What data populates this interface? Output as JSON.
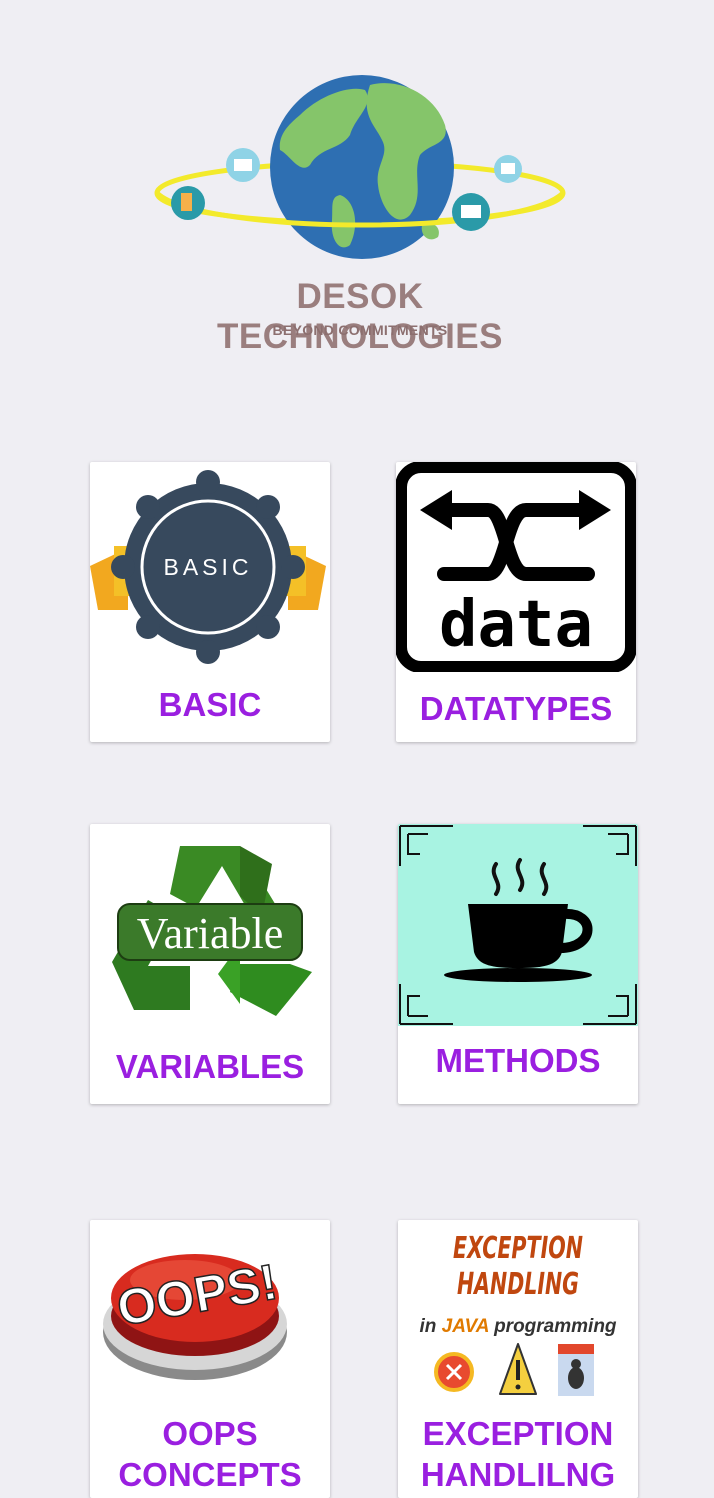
{
  "brand": {
    "name": "DESOK TECHNOLOGIES",
    "tagline": "BEYOND COMMITMENTS",
    "logo_icon": "globe-orbit-logo"
  },
  "cards": [
    {
      "label": "BASIC",
      "icon": "basic-badge-icon",
      "image_text": "BASIC"
    },
    {
      "label": "DATATYPES",
      "icon": "shuffle-data-icon",
      "image_text": "data"
    },
    {
      "label": "VARIABLES",
      "icon": "recycle-variable-icon",
      "image_text": "Variable"
    },
    {
      "label": "METHODS",
      "icon": "coffee-cup-icon"
    },
    {
      "label": "OOPS",
      "label2": "CONCEPTS",
      "icon": "oops-button-icon",
      "image_text": "OOPS!"
    },
    {
      "label": "EXCEPTION",
      "label2": "HANDLILNG",
      "icon": "exception-handling-icon",
      "image_title1": "EXCEPTION",
      "image_title2": "HANDLING",
      "image_sub_pre": "in ",
      "image_sub_java": "JAVA",
      "image_sub_post": " programming"
    }
  ],
  "colors": {
    "background": "#efeef3",
    "label": "#9a1fe0",
    "brand_text": "#9a7e7e",
    "methods_bg": "#a8f3e2"
  }
}
